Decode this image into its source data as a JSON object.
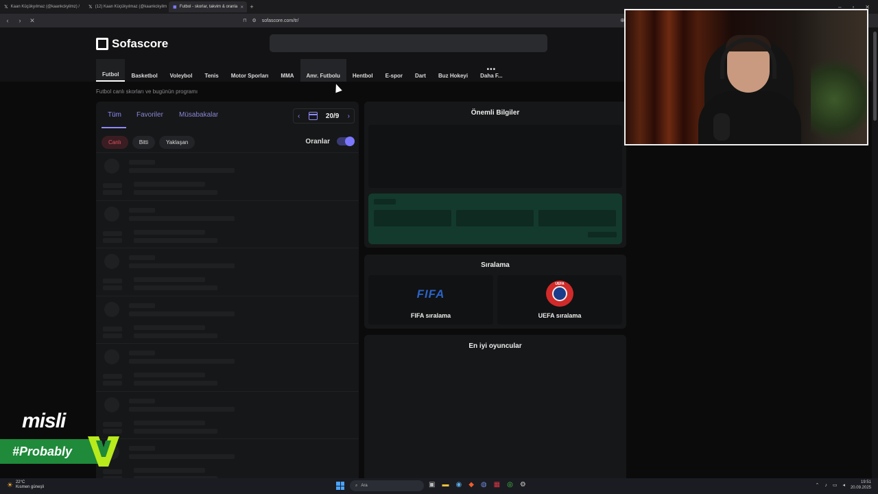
{
  "browser": {
    "tabs": [
      {
        "title": "Kaan Küçükyılmaz (@kaankckyilmz) /",
        "icon": "x-logo-icon"
      },
      {
        "title": "(12) Kaan Küçükyılmaz (@kaankckyilm",
        "icon": "x-logo-icon"
      },
      {
        "title": "Futbol - skorlar, takvim & oranla",
        "icon": "sofascore-icon",
        "active": true
      }
    ],
    "new_tab": "+",
    "url": "sofascore.com/tr/"
  },
  "site": {
    "logo": "Sofascore",
    "search_placeholder": "",
    "sports": [
      "Futbol",
      "Basketbol",
      "Voleybol",
      "Tenis",
      "Motor Sporları",
      "MMA",
      "Amr. Futbolu",
      "Hentbol",
      "E-spor",
      "Dart",
      "Buz Hokeyi"
    ],
    "more_label": "Daha F...",
    "active_sport": "Futbol",
    "subtitle": "Futbol canlı skorları ve bugünün programı"
  },
  "left": {
    "tabs": [
      "Tüm",
      "Favoriler",
      "Müsabakalar"
    ],
    "date": "20/9",
    "filters": [
      "Canlı",
      "Bitti",
      "Yaklaşan"
    ],
    "odds_label": "Oranlar",
    "odds_enabled": true
  },
  "right": {
    "important_title": "Önemli Bilgiler",
    "ranking_title": "Sıralama",
    "fifa_logo": "FIFA",
    "fifa_label": "FIFA sıralama",
    "uefa_logo": "UEFA",
    "uefa_label": "UEFA sıralama",
    "players_title": "En iyi oyuncular"
  },
  "overlay": {
    "brand": "misli",
    "tagline": "#Probably"
  },
  "taskbar": {
    "temp": "22°C",
    "weather": "Kısmen güneşli",
    "search": "Ara",
    "time": "19:51",
    "date": "20.09.2025"
  },
  "colors": {
    "accent": "#8f8bff",
    "live": "#e0525e",
    "brand_green": "#1e8a3a"
  }
}
